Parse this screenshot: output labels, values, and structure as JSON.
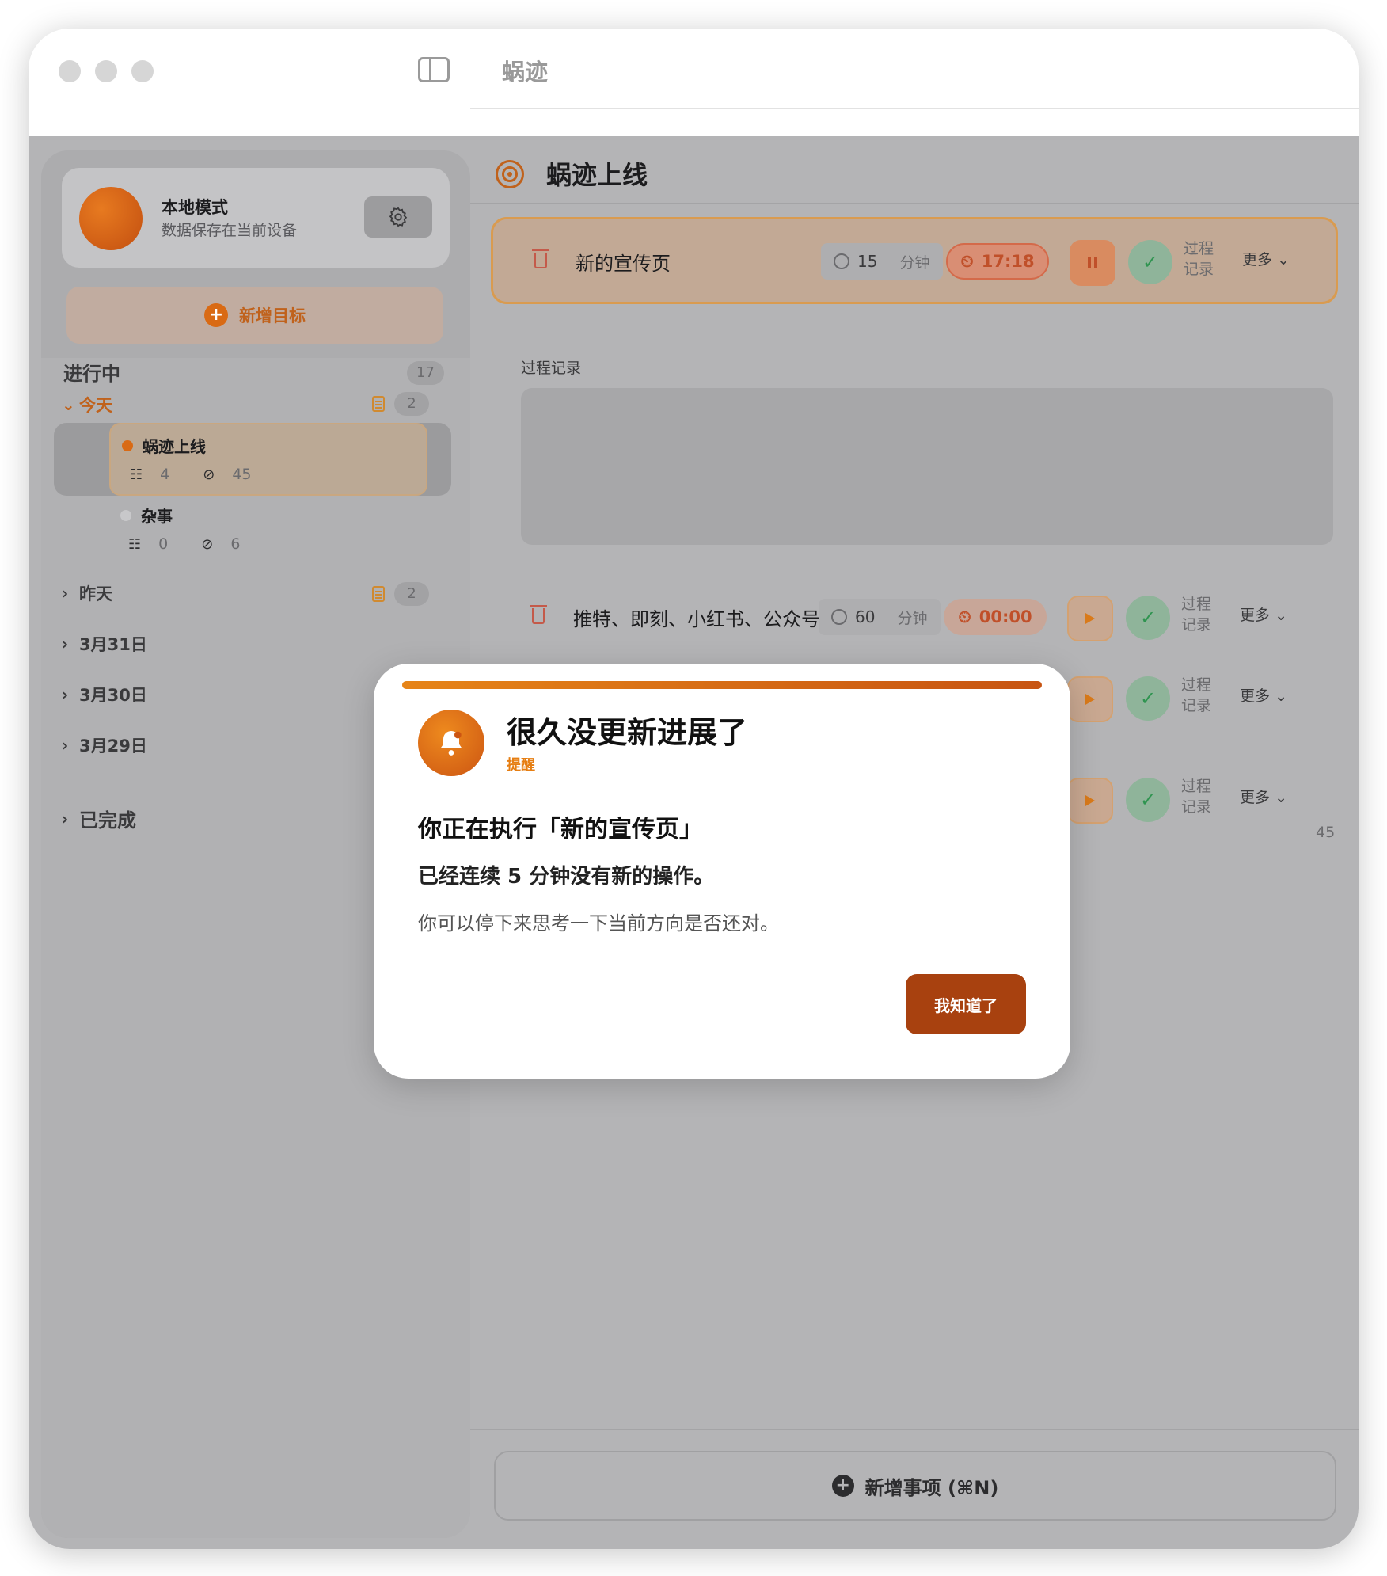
{
  "window": {
    "app_title": "蜗迹"
  },
  "profile": {
    "name": "本地模式",
    "subtitle": "数据保存在当前设备"
  },
  "sidebar": {
    "add_goal_label": "新增目标",
    "in_progress_label": "进行中",
    "in_progress_count": "17",
    "today_label": "今天",
    "today_count": "2",
    "goals": [
      {
        "name": "蜗迹上线",
        "tasks": "4",
        "done": "45",
        "dot_color": "#d96a14"
      },
      {
        "name": "杂事",
        "tasks": "0",
        "done": "6",
        "dot_color": "#c8c8ca"
      }
    ],
    "yesterday_label": "昨天",
    "yesterday_count": "2",
    "dates": [
      "3月31日",
      "3月30日",
      "3月29日"
    ],
    "completed_label": "已完成"
  },
  "main": {
    "title": "蜗迹上线",
    "log_section_title": "过程记录",
    "tasks": [
      {
        "name": "新的宣传页",
        "estimate": "15",
        "unit": "分钟",
        "timer": "17:18",
        "log": "过程记录",
        "more": "更多"
      },
      {
        "name": "推特、即刻、小红书、公众号",
        "estimate": "60",
        "unit": "分钟",
        "timer": "00:00",
        "log": "过程记录",
        "more": "更多"
      },
      {
        "log": "过程记录",
        "more": "更多"
      },
      {
        "log": "过程记录",
        "more": "更多"
      }
    ],
    "total_count": "45",
    "add_item_label": "新增事项 (⌘N)"
  },
  "modal": {
    "title": "很久没更新进展了",
    "tag": "提醒",
    "line1": "你正在执行「新的宣传页」",
    "line2": "已经连续 5 分钟没有新的操作。",
    "line3": "你可以停下来思考一下当前方向是否还对。",
    "button_label": "我知道了"
  },
  "colors": {
    "accent": "#d96a14",
    "button_dark": "#a8410f",
    "check_green": "#2f9450"
  }
}
